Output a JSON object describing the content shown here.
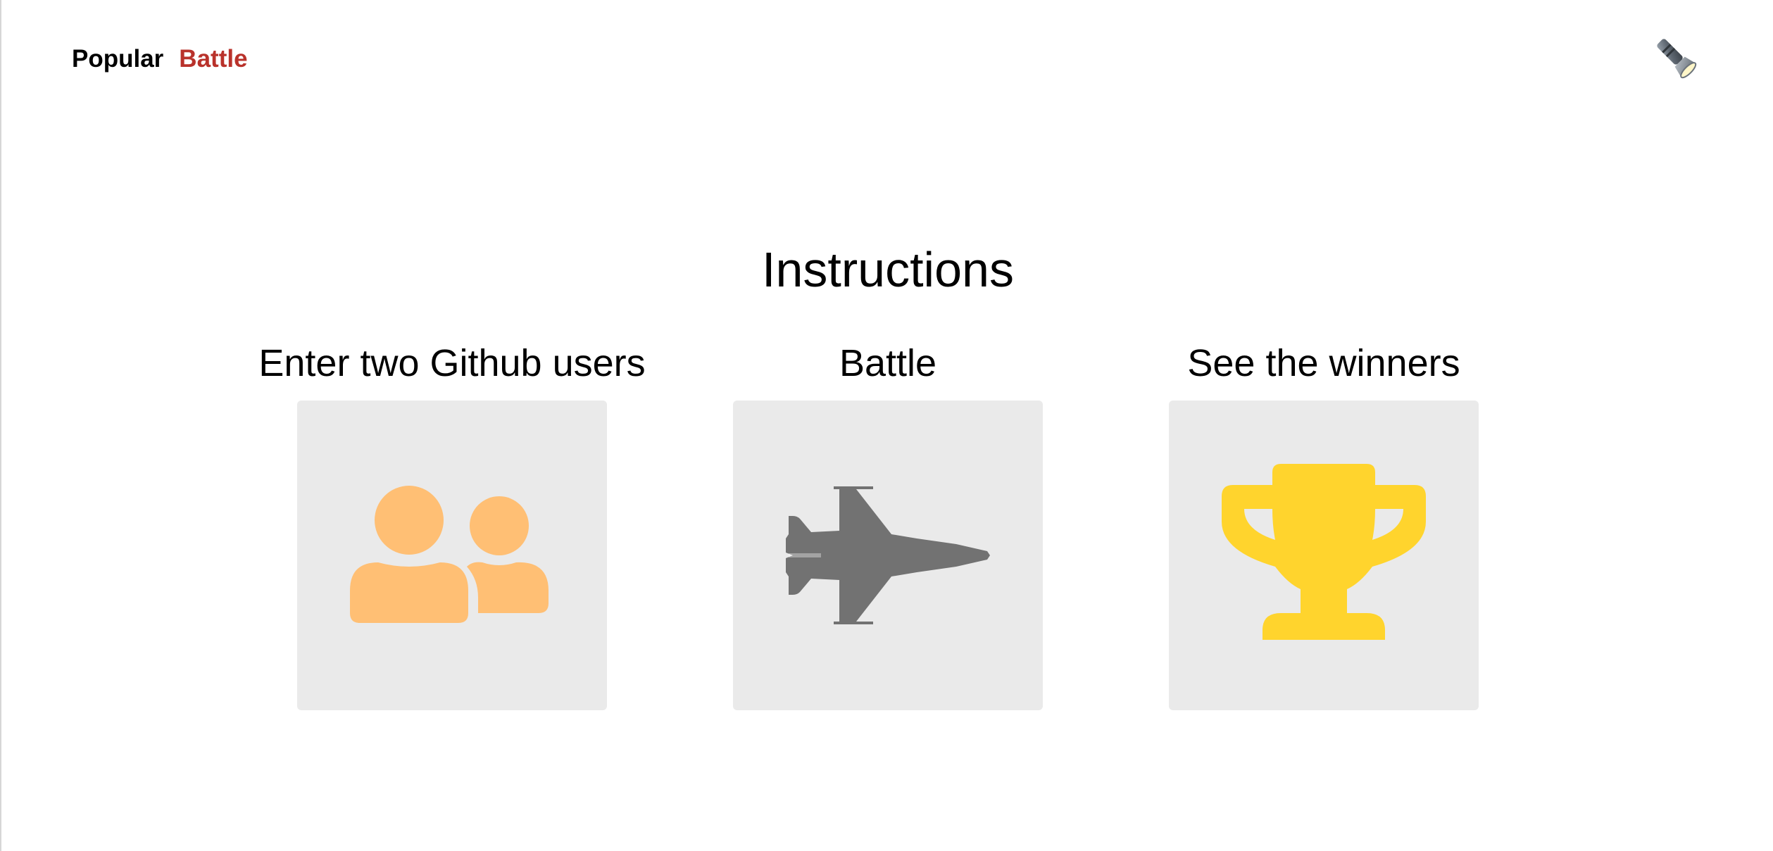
{
  "nav": {
    "items": [
      {
        "label": "Popular",
        "active": false
      },
      {
        "label": "Battle",
        "active": true
      }
    ],
    "theme_toggle_icon": "flashlight-icon"
  },
  "main": {
    "heading": "Instructions",
    "steps": [
      {
        "title": "Enter two Github users",
        "icon": "users-icon",
        "icon_color": "#ffbf74"
      },
      {
        "title": "Battle",
        "icon": "fighter-jet-icon",
        "icon_color": "#727272"
      },
      {
        "title": "See the winners",
        "icon": "trophy-icon",
        "icon_color": "#ffd42d"
      }
    ]
  },
  "colors": {
    "accent": "#b9322b",
    "card_background": "#eaeaea"
  }
}
